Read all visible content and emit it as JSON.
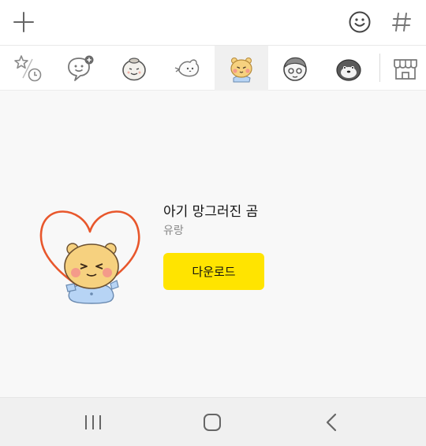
{
  "toolbar": {
    "add_icon": "plus-icon",
    "emoji_icon": "smiley-icon",
    "hashtag_icon": "hash-icon"
  },
  "tabs": [
    {
      "icon": "favorites-recent-icon"
    },
    {
      "icon": "emoticon-add-icon"
    },
    {
      "icon": "sticker-rice-ball-icon"
    },
    {
      "icon": "sticker-bird-icon"
    },
    {
      "icon": "sticker-bear-icon",
      "active": true
    },
    {
      "icon": "sticker-boy-icon"
    },
    {
      "icon": "sticker-seal-icon"
    },
    {
      "icon": "emoticon-shop-icon"
    }
  ],
  "pack": {
    "title": "아기 망그러진 곰",
    "author": "유랑",
    "download_label": "다운로드"
  },
  "colors": {
    "accent": "#ffe400",
    "active_tab_bg": "#f0f0f0",
    "content_bg": "#f8f8f8",
    "heart": "#e8572c",
    "bear_face": "#f6d17f",
    "bear_shirt": "#b7d4f5"
  },
  "system_nav": {
    "recents_icon": "recents-icon",
    "home_icon": "home-icon",
    "back_icon": "back-icon"
  }
}
